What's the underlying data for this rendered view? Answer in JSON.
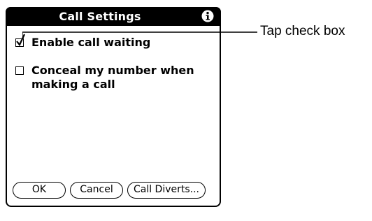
{
  "dialog": {
    "title": "Call Settings",
    "info_icon": "info-icon",
    "options": [
      {
        "label": "Enable call waiting",
        "checked": true
      },
      {
        "label": "Conceal my number when making a call",
        "checked": false
      }
    ],
    "buttons": {
      "ok": "OK",
      "cancel": "Cancel",
      "call_diverts": "Call Diverts..."
    }
  },
  "callout": {
    "text": "Tap check box"
  }
}
